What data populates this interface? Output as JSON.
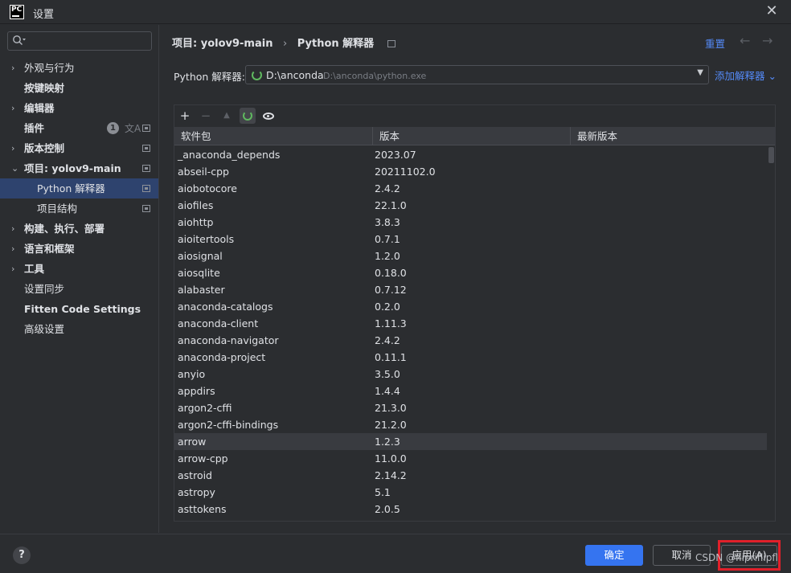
{
  "window": {
    "title": "设置",
    "logo_text": "PC"
  },
  "sidebar": {
    "search_placeholder": "",
    "items": [
      {
        "label": "外观与行为",
        "chevron": "›"
      },
      {
        "label": "按键映射"
      },
      {
        "label": "编辑器",
        "chevron": "›"
      },
      {
        "label": "插件",
        "badge": "1",
        "translate_icon": "文A"
      },
      {
        "label": "版本控制",
        "chevron": "›"
      },
      {
        "label": "项目: yolov9-main",
        "chevron": "⌄"
      },
      {
        "label": "Python 解释器"
      },
      {
        "label": "项目结构"
      },
      {
        "label": "构建、执行、部署",
        "chevron": "›"
      },
      {
        "label": "语言和框架",
        "chevron": "›"
      },
      {
        "label": "工具",
        "chevron": "›"
      },
      {
        "label": "设置同步"
      },
      {
        "label": "Fitten Code Settings"
      },
      {
        "label": "高级设置"
      }
    ]
  },
  "header": {
    "breadcrumb_project": "项目: yolov9-main",
    "breadcrumb_sep": "›",
    "breadcrumb_page": "Python 解释器",
    "reset_label": "重置",
    "back_arrow": "←",
    "forward_arrow": "→"
  },
  "interpreter": {
    "label": "Python 解释器:",
    "name": "D:\\anconda",
    "path": "D:\\anconda\\python.exe",
    "caret": "▼",
    "add_label": "添加解释器 ⌄"
  },
  "toolbar": {
    "add": "+",
    "remove": "−",
    "up": "▲"
  },
  "packages": {
    "columns": [
      "软件包",
      "版本",
      "最新版本"
    ],
    "rows": [
      {
        "name": "_anaconda_depends",
        "version": "2023.07",
        "latest": ""
      },
      {
        "name": "abseil-cpp",
        "version": "20211102.0",
        "latest": ""
      },
      {
        "name": "aiobotocore",
        "version": "2.4.2",
        "latest": ""
      },
      {
        "name": "aiofiles",
        "version": "22.1.0",
        "latest": ""
      },
      {
        "name": "aiohttp",
        "version": "3.8.3",
        "latest": ""
      },
      {
        "name": "aioitertools",
        "version": "0.7.1",
        "latest": ""
      },
      {
        "name": "aiosignal",
        "version": "1.2.0",
        "latest": ""
      },
      {
        "name": "aiosqlite",
        "version": "0.18.0",
        "latest": ""
      },
      {
        "name": "alabaster",
        "version": "0.7.12",
        "latest": ""
      },
      {
        "name": "anaconda-catalogs",
        "version": "0.2.0",
        "latest": ""
      },
      {
        "name": "anaconda-client",
        "version": "1.11.3",
        "latest": ""
      },
      {
        "name": "anaconda-navigator",
        "version": "2.4.2",
        "latest": ""
      },
      {
        "name": "anaconda-project",
        "version": "0.11.1",
        "latest": ""
      },
      {
        "name": "anyio",
        "version": "3.5.0",
        "latest": ""
      },
      {
        "name": "appdirs",
        "version": "1.4.4",
        "latest": ""
      },
      {
        "name": "argon2-cffi",
        "version": "21.3.0",
        "latest": ""
      },
      {
        "name": "argon2-cffi-bindings",
        "version": "21.2.0",
        "latest": ""
      },
      {
        "name": "arrow",
        "version": "1.2.3",
        "latest": ""
      },
      {
        "name": "arrow-cpp",
        "version": "11.0.0",
        "latest": ""
      },
      {
        "name": "astroid",
        "version": "2.14.2",
        "latest": ""
      },
      {
        "name": "astropy",
        "version": "5.1",
        "latest": ""
      },
      {
        "name": "asttokens",
        "version": "2.0.5",
        "latest": ""
      }
    ]
  },
  "footer": {
    "help": "?",
    "ok": "确定",
    "cancel": "取消",
    "apply": "应用(A)",
    "watermark": "CSDN @flipriflipfl"
  },
  "colors": {
    "background": "#2b2d30",
    "selection": "#2e436e",
    "accent": "#3574f0",
    "link": "#548af7",
    "spinner": "#5fb85f",
    "highlight_frame": "#e0202a"
  }
}
